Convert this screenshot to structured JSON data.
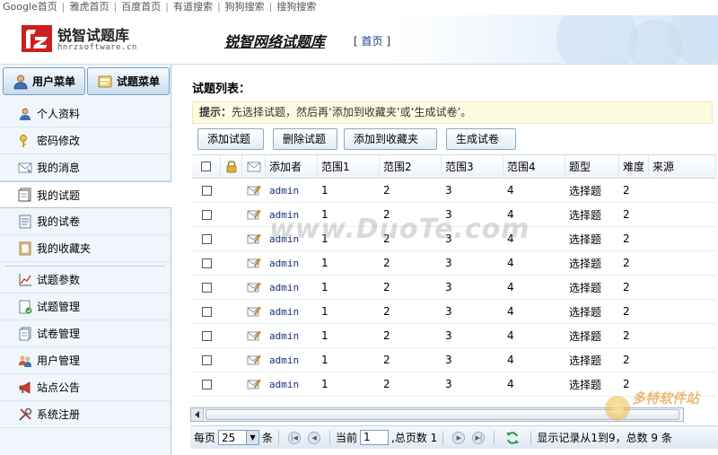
{
  "topnav": {
    "links": [
      "Google首页",
      "雅虎首页",
      "百度首页",
      "有道搜索",
      "狗狗搜索",
      "搜狗搜索"
    ]
  },
  "header": {
    "logo_title": "锐智试题库",
    "logo_sub": "hnrzsoftware.cn",
    "site_title": "锐智网络试题库",
    "home_link": "首页"
  },
  "sidebar": {
    "tabs": [
      "用户菜单",
      "试题菜单"
    ],
    "items": [
      {
        "label": "个人资料",
        "icon": "user-icon"
      },
      {
        "label": "密码修改",
        "icon": "key-icon"
      },
      {
        "label": "我的消息",
        "icon": "message-icon"
      },
      {
        "label": "我的试题",
        "icon": "document-icon",
        "active": true
      },
      {
        "label": "我的试卷",
        "icon": "paper-icon"
      },
      {
        "label": "我的收藏夹",
        "icon": "favorites-icon"
      },
      {
        "label": "试题参数",
        "icon": "chart-icon"
      },
      {
        "label": "试题管理",
        "icon": "manage-icon"
      },
      {
        "label": "试卷管理",
        "icon": "papers-manage-icon"
      },
      {
        "label": "用户管理",
        "icon": "users-icon"
      },
      {
        "label": "站点公告",
        "icon": "megaphone-icon"
      },
      {
        "label": "系统注册",
        "icon": "tools-icon"
      }
    ]
  },
  "main": {
    "heading": "试题列表：",
    "tip_label": "提示：",
    "tip_text": "先选择试题，然后再‘添加到收藏夹’或‘生成试卷’。",
    "buttons": {
      "add": "添加试题",
      "delete": "删除试题",
      "favorite": "添加到收藏夹",
      "generate": "生成试卷"
    },
    "columns": {
      "author": "添加者",
      "range1": "范围1",
      "range2": "范围2",
      "range3": "范围3",
      "range4": "范围4",
      "type": "题型",
      "difficulty": "难度",
      "source": "来源"
    },
    "rows": [
      {
        "author": "admin",
        "r1": "1",
        "r2": "2",
        "r3": "3",
        "r4": "4",
        "type": "选择题",
        "difficulty": "2",
        "source": ""
      },
      {
        "author": "admin",
        "r1": "1",
        "r2": "2",
        "r3": "3",
        "r4": "4",
        "type": "选择题",
        "difficulty": "2",
        "source": ""
      },
      {
        "author": "admin",
        "r1": "1",
        "r2": "2",
        "r3": "3",
        "r4": "4",
        "type": "选择题",
        "difficulty": "2",
        "source": ""
      },
      {
        "author": "admin",
        "r1": "1",
        "r2": "2",
        "r3": "3",
        "r4": "4",
        "type": "选择题",
        "difficulty": "2",
        "source": ""
      },
      {
        "author": "admin",
        "r1": "1",
        "r2": "2",
        "r3": "3",
        "r4": "4",
        "type": "选择题",
        "difficulty": "2",
        "source": ""
      },
      {
        "author": "admin",
        "r1": "1",
        "r2": "2",
        "r3": "3",
        "r4": "4",
        "type": "选择题",
        "difficulty": "2",
        "source": ""
      },
      {
        "author": "admin",
        "r1": "1",
        "r2": "2",
        "r3": "3",
        "r4": "4",
        "type": "选择题",
        "difficulty": "2",
        "source": ""
      },
      {
        "author": "admin",
        "r1": "1",
        "r2": "2",
        "r3": "3",
        "r4": "4",
        "type": "选择题",
        "difficulty": "2",
        "source": ""
      },
      {
        "author": "admin",
        "r1": "1",
        "r2": "2",
        "r3": "3",
        "r4": "4",
        "type": "选择题",
        "difficulty": "2",
        "source": ""
      }
    ],
    "pager": {
      "per_page_label": "每页",
      "per_page_value": "25",
      "per_page_unit": "条",
      "current_label": "当前",
      "current_value": "1",
      "total_pages": ",总页数 1",
      "records": "显示记录从1到9，总数 9 条"
    }
  },
  "watermark": {
    "text": "www.DuoTe.com",
    "badge_text": "多特软件站"
  },
  "colors": {
    "sidebar_bg": "#f0f6fb",
    "accent_border": "#a9c6df",
    "link_blue": "#1a2f7a",
    "tip_bg": "#fdfbe0"
  }
}
